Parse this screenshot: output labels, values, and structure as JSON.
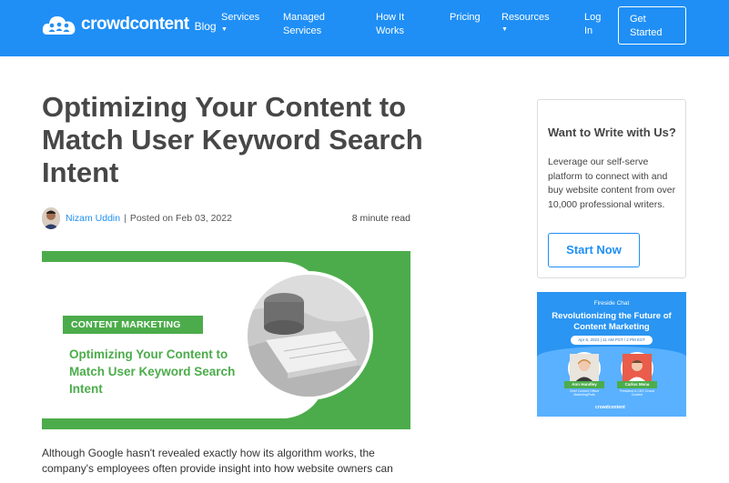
{
  "header": {
    "logo_word": "crowdcontent",
    "logo_blog": "Blog",
    "nav": [
      {
        "label": "Services",
        "has_dropdown": true
      },
      {
        "label": "Managed Services",
        "has_dropdown": false
      },
      {
        "label": "How It Works",
        "has_dropdown": false
      },
      {
        "label": "Pricing",
        "has_dropdown": false
      },
      {
        "label": "Resources",
        "has_dropdown": true
      },
      {
        "label": "Log In",
        "has_dropdown": false
      }
    ],
    "cta": "Get Started",
    "brand_color": "#1f8ff5"
  },
  "article": {
    "title": "Optimizing Your Content to Match User Keyword Search Intent",
    "author": "Nizam Uddin",
    "posted": "Posted on Feb 03, 2022",
    "read_time": "8 minute read",
    "image": {
      "badge": "CONTENT MARKETING",
      "headline": "Optimizing Your Content to Match User Keyword Search Intent",
      "accent": "#4cac4b"
    },
    "body_start": "Although Google hasn't revealed exactly how its algorithm works, the company's employees often provide insight into how website owners can"
  },
  "sidebar": {
    "card": {
      "title": "Want to Write with Us?",
      "text": "Leverage our self-serve platform to connect with and buy website content from over 10,000 professional writers.",
      "button": "Start Now"
    },
    "promo": {
      "kicker": "Fireside Chat",
      "title": "Revolutionizing the Future of Content Marketing",
      "date": "Apr 6, 2023  |  11 AM PST / 2 PM EST",
      "speakers": [
        {
          "name": "Ann Handley",
          "role": "Chief Content Officer MarketingProfs"
        },
        {
          "name": "Carlos Mena",
          "role": "President & CEO Crowd Content"
        }
      ],
      "logo": "crowdcontent"
    }
  }
}
